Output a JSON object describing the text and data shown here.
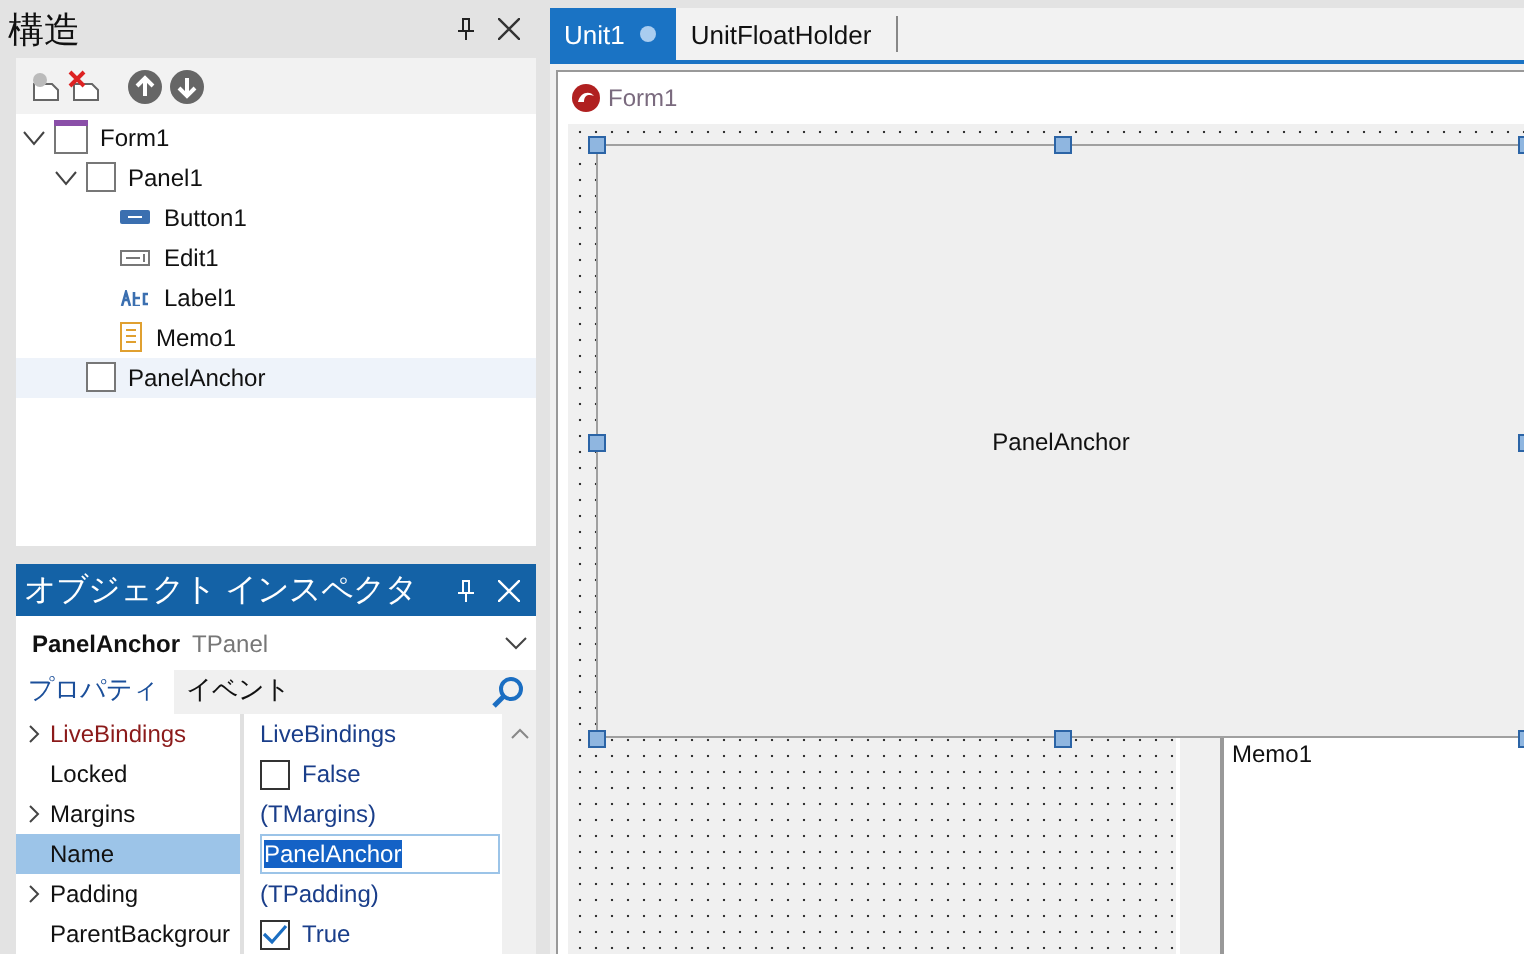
{
  "structure_panel": {
    "title": "構造",
    "tree": [
      {
        "label": "Form1",
        "kind": "form",
        "selected": false,
        "expanded": true,
        "children": [
          {
            "label": "Panel1",
            "kind": "panel",
            "selected": false,
            "expanded": true,
            "children": [
              {
                "label": "Button1",
                "kind": "button",
                "selected": false
              },
              {
                "label": "Edit1",
                "kind": "edit",
                "selected": false
              },
              {
                "label": "Label1",
                "kind": "label",
                "selected": false
              },
              {
                "label": "Memo1",
                "kind": "memo",
                "selected": false
              }
            ]
          },
          {
            "label": "PanelAnchor",
            "kind": "panel",
            "selected": true
          }
        ]
      }
    ]
  },
  "object_inspector": {
    "title": "オブジェクト インスペクタ",
    "object_name": "PanelAnchor",
    "object_type": "TPanel",
    "tabs": [
      {
        "label": "プロパティ",
        "selected": true
      },
      {
        "label": "イベント",
        "selected": false
      }
    ],
    "properties": [
      {
        "name": "LiveBindings",
        "value": "LiveBindings",
        "kind": "binding",
        "expandable": true,
        "selected": false
      },
      {
        "name": "Locked",
        "value": "False",
        "kind": "check",
        "checked": false,
        "expandable": false,
        "selected": false
      },
      {
        "name": "Margins",
        "value": "(TMargins)",
        "kind": "object",
        "expandable": true,
        "selected": false
      },
      {
        "name": "Name",
        "value": "PanelAnchor",
        "kind": "text",
        "expandable": false,
        "selected": true
      },
      {
        "name": "Padding",
        "value": "(TPadding)",
        "kind": "object",
        "expandable": true,
        "selected": false
      },
      {
        "name": "ParentBackgrour",
        "value": "True",
        "kind": "check",
        "checked": true,
        "expandable": false,
        "selected": false
      }
    ]
  },
  "editor_tabs": [
    {
      "label": "Unit1",
      "selected": true,
      "modified": true
    },
    {
      "label": "UnitFloatHolder",
      "selected": false,
      "modified": false
    }
  ],
  "form_designer": {
    "caption": "Form1",
    "panel_caption": "PanelAnchor",
    "memo_text": "Memo1"
  }
}
